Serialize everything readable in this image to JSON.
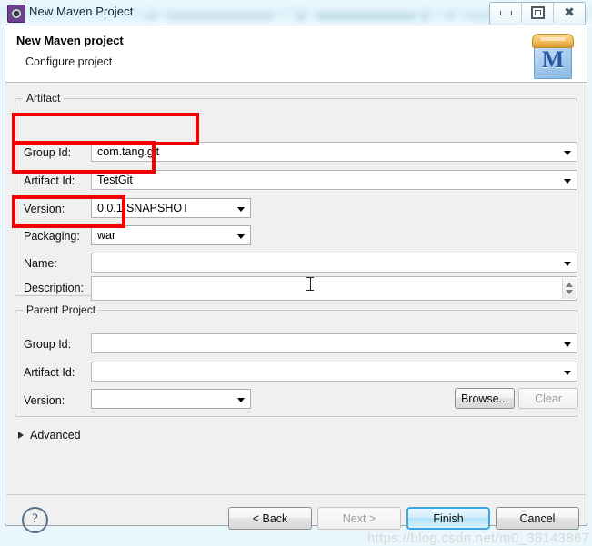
{
  "window": {
    "title": "New Maven Project",
    "icon": "maven-gear-icon",
    "controls": {
      "minimize": "Minimize",
      "maximize": "Restore",
      "close": "Close"
    }
  },
  "header": {
    "title": "New Maven project",
    "subtitle": "Configure project",
    "icon": "maven-folder-icon",
    "icon_letter": "M"
  },
  "artifact": {
    "group_title": "Artifact",
    "fields": [
      {
        "label": "Group Id:",
        "value": "com.tang.git",
        "type": "combo"
      },
      {
        "label": "Artifact Id:",
        "value": "TestGit",
        "type": "combo"
      },
      {
        "label": "Version:",
        "value": "0.0.1-SNAPSHOT",
        "type": "combo"
      },
      {
        "label": "Packaging:",
        "value": "war",
        "type": "combo"
      },
      {
        "label": "Name:",
        "value": "",
        "type": "combo"
      },
      {
        "label": "Description:",
        "value": "",
        "type": "textarea"
      }
    ]
  },
  "parent_project": {
    "group_title": "Parent Project",
    "fields": [
      {
        "label": "Group Id:",
        "value": "",
        "type": "combo"
      },
      {
        "label": "Artifact Id:",
        "value": "",
        "type": "combo"
      },
      {
        "label": "Version:",
        "value": "",
        "type": "combo"
      }
    ],
    "browse_label": "Browse...",
    "clear_label": "Clear",
    "clear_enabled": false
  },
  "advanced": {
    "label": "Advanced",
    "expanded": false
  },
  "footer": {
    "help_icon": "?",
    "buttons": [
      {
        "label": "< Back",
        "enabled": true,
        "default": false
      },
      {
        "label": "Next >",
        "enabled": false,
        "default": false
      },
      {
        "label": "Finish",
        "enabled": true,
        "default": true
      },
      {
        "label": "Cancel",
        "enabled": true,
        "default": false
      }
    ]
  },
  "annotations": {
    "color": "#f40000",
    "boxes": [
      "group-id-highlight",
      "artifact-id-highlight",
      "packaging-highlight"
    ]
  },
  "watermark": "https://blog.csdn.net/m0_38143867"
}
